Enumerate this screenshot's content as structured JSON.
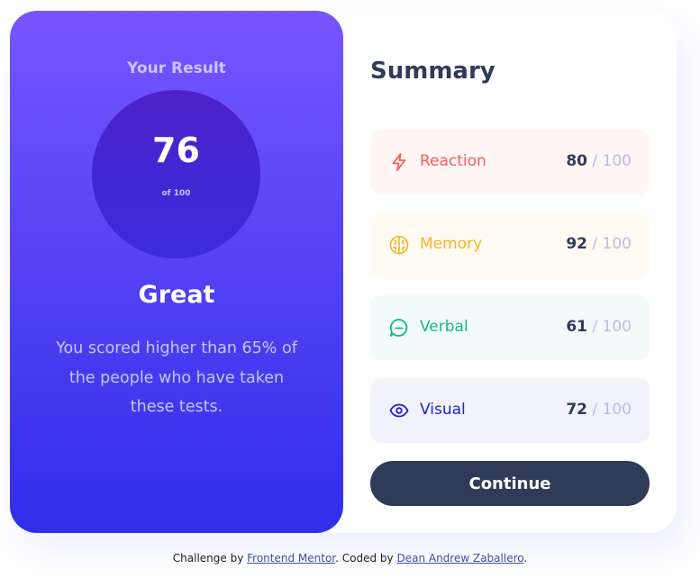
{
  "result": {
    "heading": "Your Result",
    "score": "76",
    "score_of": "of 100",
    "rating": "Great",
    "description": "You scored higher than 65% of the people who have taken these tests."
  },
  "summary": {
    "title": "Summary",
    "items": [
      {
        "label": "Reaction",
        "score": "80",
        "max": "/ 100",
        "icon": "lightning-icon",
        "color": "#f55b5b",
        "bg": "#fff6f5"
      },
      {
        "label": "Memory",
        "score": "92",
        "max": "/ 100",
        "icon": "brain-icon",
        "color": "#f5b428",
        "bg": "#fffbf2"
      },
      {
        "label": "Verbal",
        "score": "61",
        "max": "/ 100",
        "icon": "chat-bubble-icon",
        "color": "#14b88a",
        "bg": "#f2fbfa"
      },
      {
        "label": "Visual",
        "score": "72",
        "max": "/ 100",
        "icon": "eye-icon",
        "color": "#1d22cc",
        "bg": "#f2f2fd"
      }
    ],
    "continue_label": "Continue"
  },
  "attribution": {
    "prefix": "Challenge by ",
    "link1": "Frontend Mentor",
    "middle": ". Coded by ",
    "link2": "Dean Andrew Zaballero",
    "suffix": "."
  },
  "colors": {
    "gradient_top": "#7755ff",
    "gradient_bottom": "#2f2ee9",
    "dark_navy": "#303b5a"
  }
}
